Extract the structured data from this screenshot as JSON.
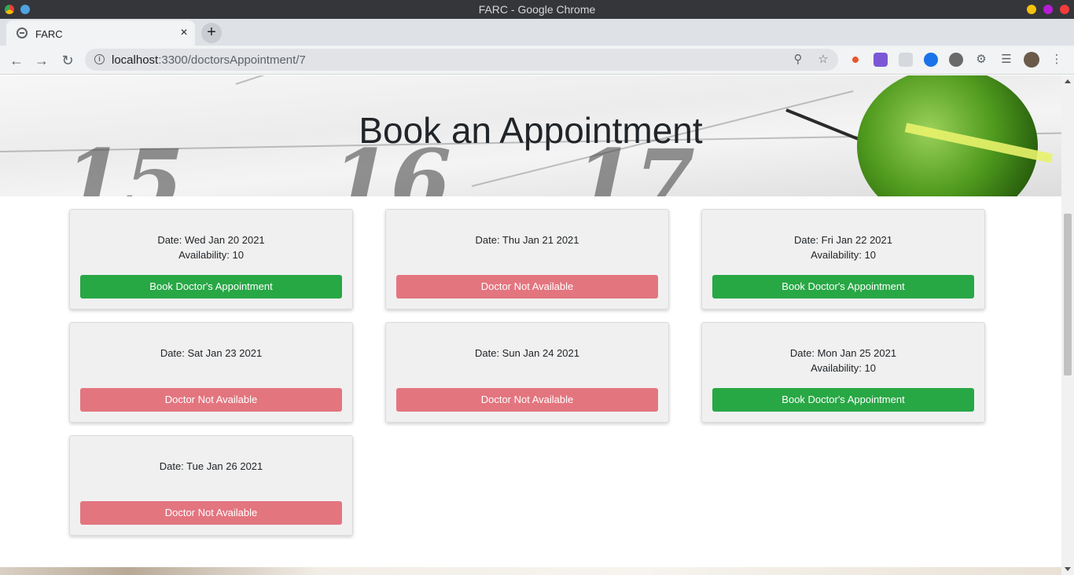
{
  "window": {
    "title": "FARC - Google Chrome"
  },
  "tab": {
    "title": "FARC",
    "close": "×",
    "new_tab": "+"
  },
  "address": {
    "host": "localhost",
    "path": ":3300/doctorsAppointment/7"
  },
  "page": {
    "heading": "Book an Appointment",
    "cards": [
      {
        "date": "Date: Wed Jan 20 2021",
        "availability": "Availability: 10",
        "button": "Book Doctor's Appointment",
        "status": "available"
      },
      {
        "date": "Date: Thu Jan 21 2021",
        "availability": "",
        "button": "Doctor Not Available",
        "status": "unavailable"
      },
      {
        "date": "Date: Fri Jan 22 2021",
        "availability": "Availability: 10",
        "button": "Book Doctor's Appointment",
        "status": "available"
      },
      {
        "date": "Date: Sat Jan 23 2021",
        "availability": "",
        "button": "Doctor Not Available",
        "status": "unavailable"
      },
      {
        "date": "Date: Sun Jan 24 2021",
        "availability": "",
        "button": "Doctor Not Available",
        "status": "unavailable"
      },
      {
        "date": "Date: Mon Jan 25 2021",
        "availability": "Availability: 10",
        "button": "Book Doctor's Appointment",
        "status": "available"
      },
      {
        "date": "Date: Tue Jan 26 2021",
        "availability": "",
        "button": "Doctor Not Available",
        "status": "unavailable"
      }
    ]
  },
  "colors": {
    "book_button": "#28a745",
    "unavailable_button": "#e3757f",
    "titlebar": "#35363a"
  },
  "icons": {
    "back": "back-arrow-icon",
    "forward": "forward-arrow-icon",
    "reload": "reload-icon",
    "site_info": "info-icon",
    "zoom": "zoom-out-icon",
    "bookmark": "star-icon",
    "extensions": "puzzle-icon",
    "menu": "kebab-menu-icon"
  }
}
